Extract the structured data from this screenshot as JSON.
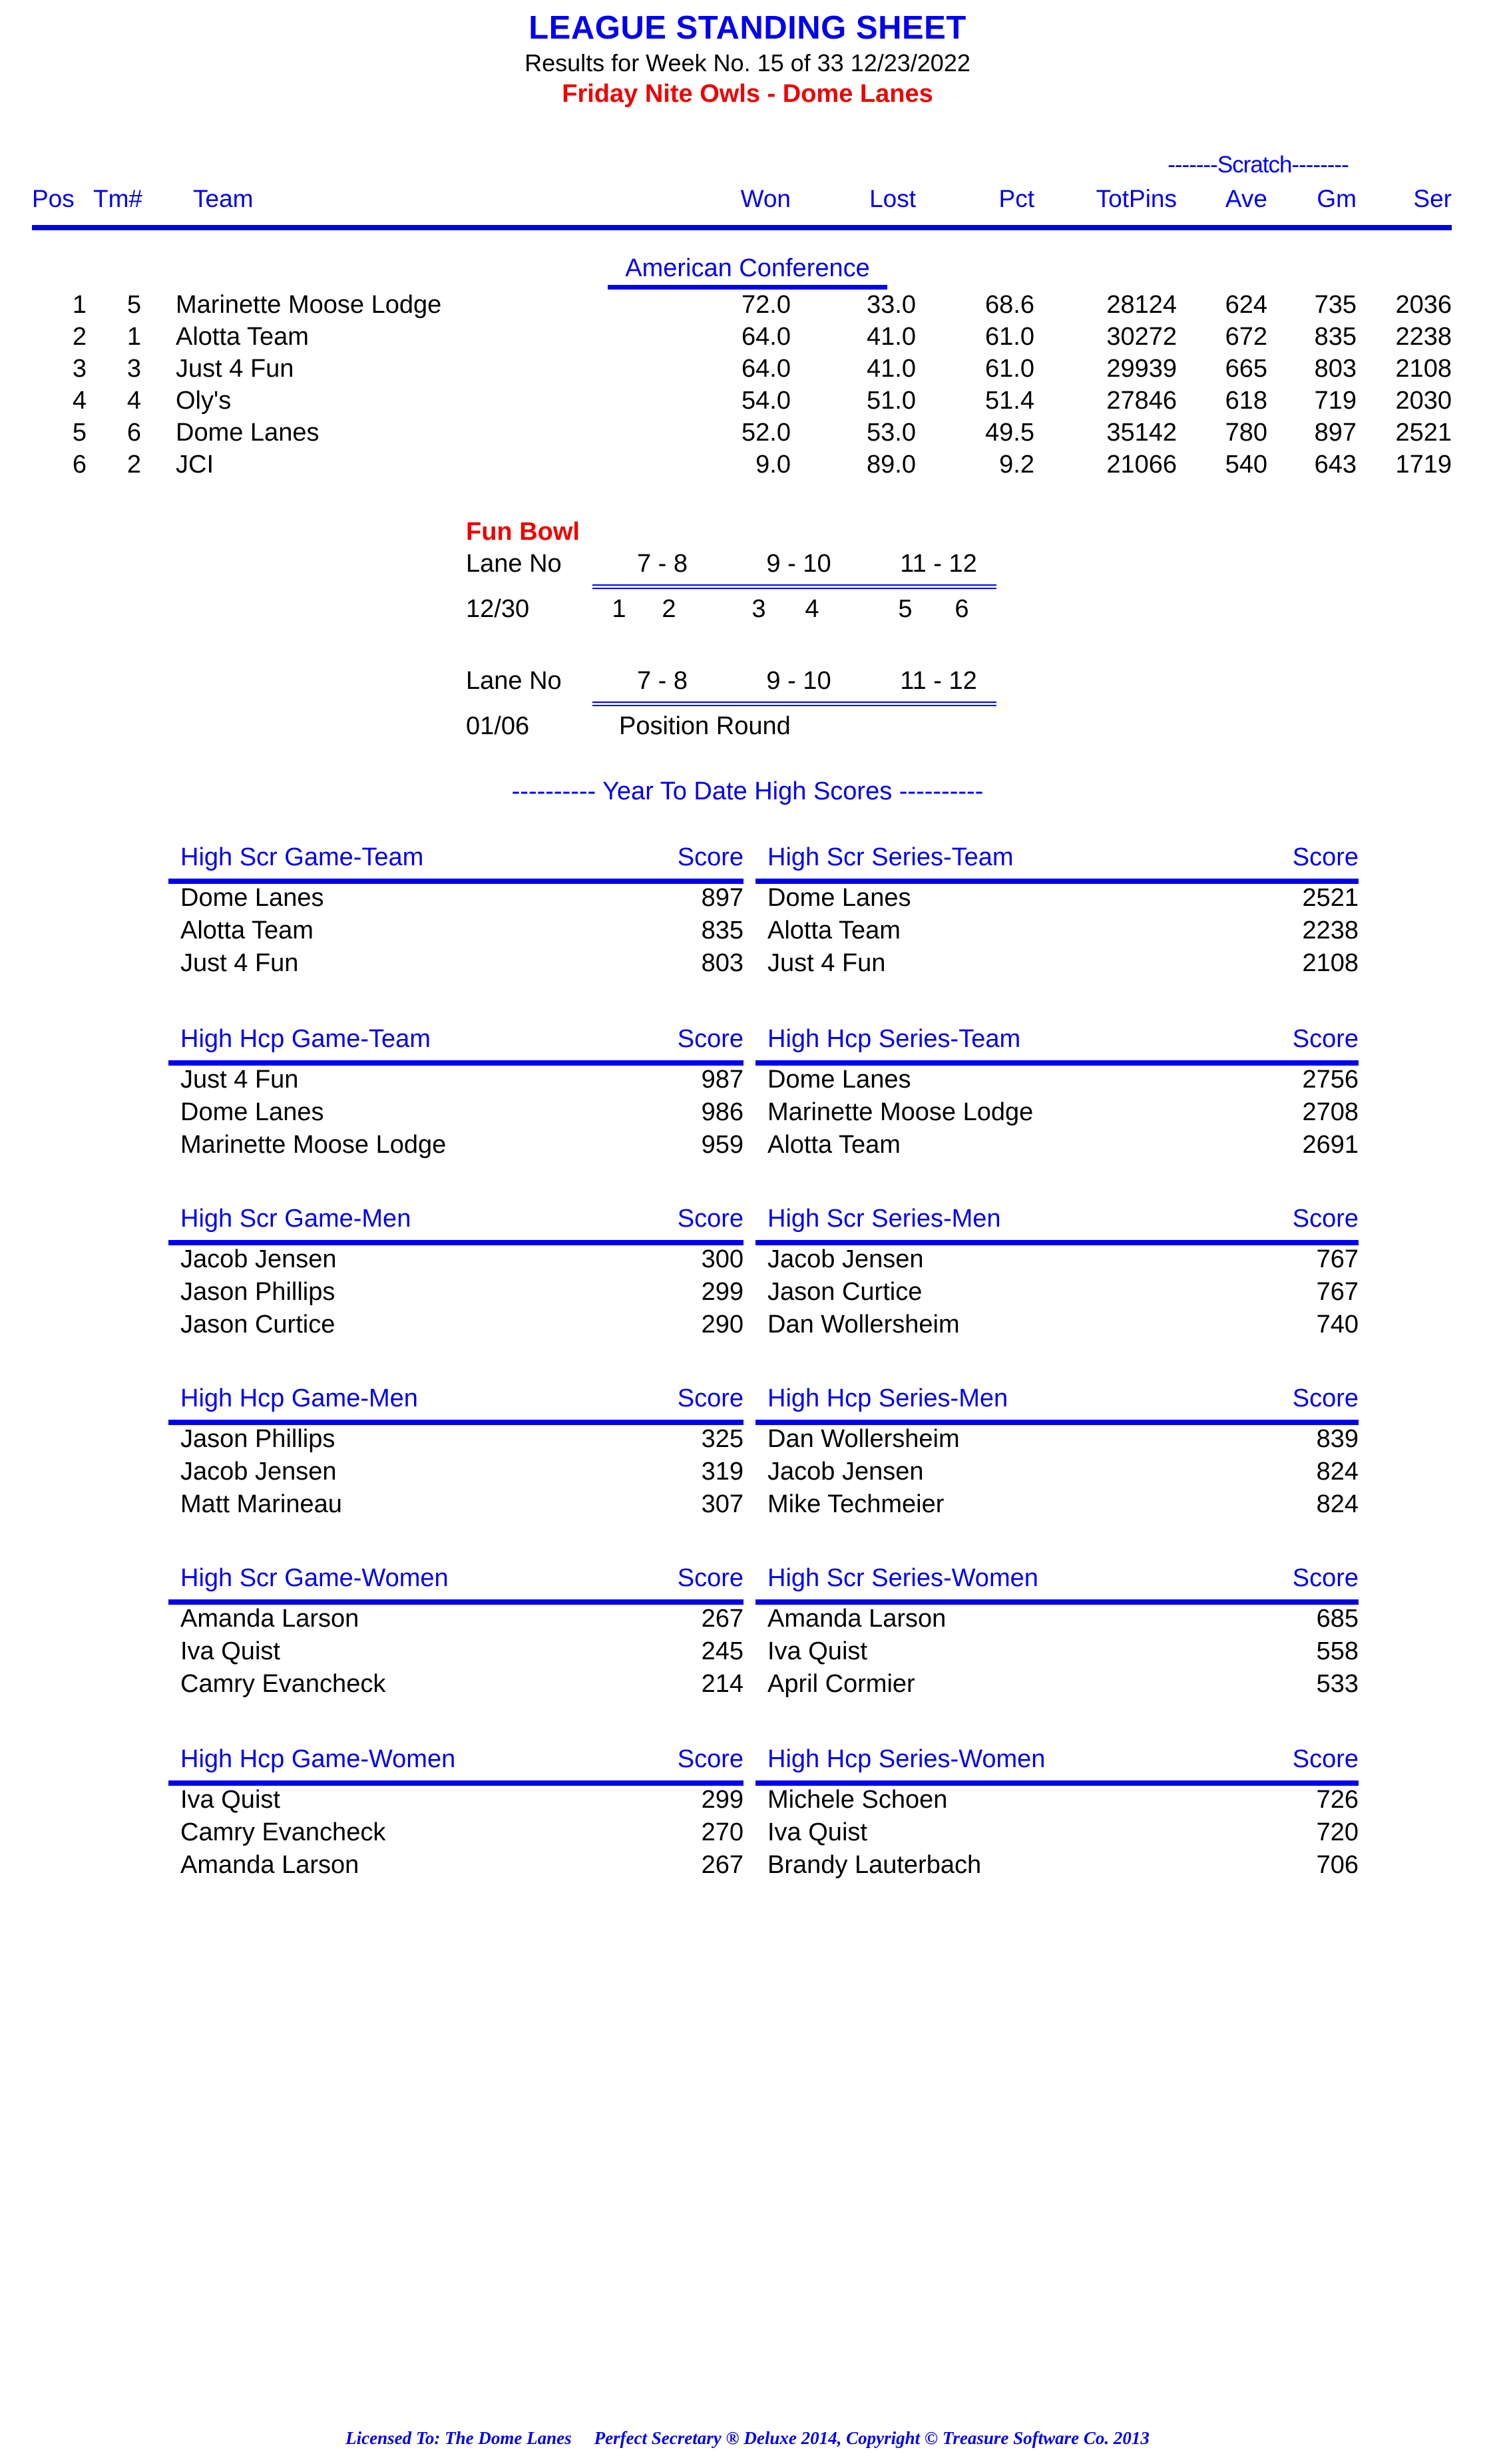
{
  "header": {
    "title": "LEAGUE STANDING SHEET",
    "subtitle": "Results for Week No. 15 of 33    12/23/2022",
    "league": "Friday Nite Owls - Dome Lanes"
  },
  "standings": {
    "scratch_label": "-------Scratch--------",
    "columns": {
      "pos": "Pos",
      "tm": "Tm#",
      "team": "Team",
      "won": "Won",
      "lost": "Lost",
      "pct": "Pct",
      "totpins": "TotPins",
      "ave": "Ave",
      "gm": "Gm",
      "ser": "Ser"
    },
    "conference": "American Conference",
    "rows": [
      {
        "pos": "1",
        "tm": "5",
        "team": "Marinette Moose Lodge",
        "won": "72.0",
        "lost": "33.0",
        "pct": "68.6",
        "totpins": "28124",
        "ave": "624",
        "gm": "735",
        "ser": "2036"
      },
      {
        "pos": "2",
        "tm": "1",
        "team": "Alotta Team",
        "won": "64.0",
        "lost": "41.0",
        "pct": "61.0",
        "totpins": "30272",
        "ave": "672",
        "gm": "835",
        "ser": "2238"
      },
      {
        "pos": "3",
        "tm": "3",
        "team": "Just 4 Fun",
        "won": "64.0",
        "lost": "41.0",
        "pct": "61.0",
        "totpins": "29939",
        "ave": "665",
        "gm": "803",
        "ser": "2108"
      },
      {
        "pos": "4",
        "tm": "4",
        "team": "Oly's",
        "won": "54.0",
        "lost": "51.0",
        "pct": "51.4",
        "totpins": "27846",
        "ave": "618",
        "gm": "719",
        "ser": "2030"
      },
      {
        "pos": "5",
        "tm": "6",
        "team": "Dome Lanes",
        "won": "52.0",
        "lost": "53.0",
        "pct": "49.5",
        "totpins": "35142",
        "ave": "780",
        "gm": "897",
        "ser": "2521"
      },
      {
        "pos": "6",
        "tm": "2",
        "team": "JCI",
        "won": "9.0",
        "lost": "89.0",
        "pct": "9.2",
        "totpins": "21066",
        "ave": "540",
        "gm": "643",
        "ser": "1719"
      }
    ]
  },
  "fun_bowl": {
    "title": "Fun Bowl",
    "schedule": [
      {
        "lane_label": "Lane No",
        "lane_pairs": [
          "7 -  8",
          "9 - 10",
          "11 - 12"
        ],
        "date": "12/30",
        "matchups": [
          [
            "1",
            "2"
          ],
          [
            "3",
            "4"
          ],
          [
            "5",
            "6"
          ]
        ],
        "note": ""
      },
      {
        "lane_label": "Lane No",
        "lane_pairs": [
          "7 -  8",
          "9 - 10",
          "11 - 12"
        ],
        "date": "01/06",
        "matchups": [],
        "note": "Position Round"
      }
    ]
  },
  "ytd": {
    "banner": "---------- Year To Date High Scores ----------",
    "score_header": "Score",
    "blocks": [
      {
        "left": {
          "header": "High Scr Game-Team",
          "rows": [
            {
              "name": "Dome Lanes",
              "score": "897"
            },
            {
              "name": "Alotta Team",
              "score": "835"
            },
            {
              "name": "Just 4 Fun",
              "score": "803"
            }
          ]
        },
        "right": {
          "header": "High Scr Series-Team",
          "rows": [
            {
              "name": "Dome Lanes",
              "score": "2521"
            },
            {
              "name": "Alotta Team",
              "score": "2238"
            },
            {
              "name": "Just 4 Fun",
              "score": "2108"
            }
          ]
        }
      },
      {
        "left": {
          "header": "High Hcp Game-Team",
          "rows": [
            {
              "name": "Just 4 Fun",
              "score": "987"
            },
            {
              "name": "Dome Lanes",
              "score": "986"
            },
            {
              "name": "Marinette Moose Lodge",
              "score": "959"
            }
          ]
        },
        "right": {
          "header": "High Hcp Series-Team",
          "rows": [
            {
              "name": "Dome Lanes",
              "score": "2756"
            },
            {
              "name": "Marinette Moose Lodge",
              "score": "2708"
            },
            {
              "name": "Alotta Team",
              "score": "2691"
            }
          ]
        }
      },
      {
        "left": {
          "header": "High Scr Game-Men",
          "rows": [
            {
              "name": "Jacob Jensen",
              "score": "300"
            },
            {
              "name": "Jason Phillips",
              "score": "299"
            },
            {
              "name": "Jason Curtice",
              "score": "290"
            }
          ]
        },
        "right": {
          "header": "High Scr Series-Men",
          "rows": [
            {
              "name": "Jacob Jensen",
              "score": "767"
            },
            {
              "name": "Jason Curtice",
              "score": "767"
            },
            {
              "name": "Dan Wollersheim",
              "score": "740"
            }
          ]
        }
      },
      {
        "left": {
          "header": "High Hcp Game-Men",
          "rows": [
            {
              "name": "Jason Phillips",
              "score": "325"
            },
            {
              "name": "Jacob Jensen",
              "score": "319"
            },
            {
              "name": "Matt Marineau",
              "score": "307"
            }
          ]
        },
        "right": {
          "header": "High Hcp Series-Men",
          "rows": [
            {
              "name": "Dan Wollersheim",
              "score": "839"
            },
            {
              "name": "Jacob Jensen",
              "score": "824"
            },
            {
              "name": "Mike Techmeier",
              "score": "824"
            }
          ]
        }
      },
      {
        "left": {
          "header": "High Scr Game-Women",
          "rows": [
            {
              "name": "Amanda Larson",
              "score": "267"
            },
            {
              "name": "Iva Quist",
              "score": "245"
            },
            {
              "name": "Camry Evancheck",
              "score": "214"
            }
          ]
        },
        "right": {
          "header": "High Scr Series-Women",
          "rows": [
            {
              "name": "Amanda Larson",
              "score": "685"
            },
            {
              "name": "Iva Quist",
              "score": "558"
            },
            {
              "name": "April Cormier",
              "score": "533"
            }
          ]
        }
      },
      {
        "left": {
          "header": "High Hcp Game-Women",
          "rows": [
            {
              "name": "Iva Quist",
              "score": "299"
            },
            {
              "name": "Camry Evancheck",
              "score": "270"
            },
            {
              "name": "Amanda Larson",
              "score": "267"
            }
          ]
        },
        "right": {
          "header": "High Hcp Series-Women",
          "rows": [
            {
              "name": "Michele Schoen",
              "score": "726"
            },
            {
              "name": "Iva Quist",
              "score": "720"
            },
            {
              "name": "Brandy Lauterbach",
              "score": "706"
            }
          ]
        }
      }
    ]
  },
  "footer": {
    "licensed_to": "Licensed To: The Dome Lanes",
    "copyright": "Perfect Secretary ® Deluxe  2014, Copyright © Treasure Software Co. 2013"
  }
}
